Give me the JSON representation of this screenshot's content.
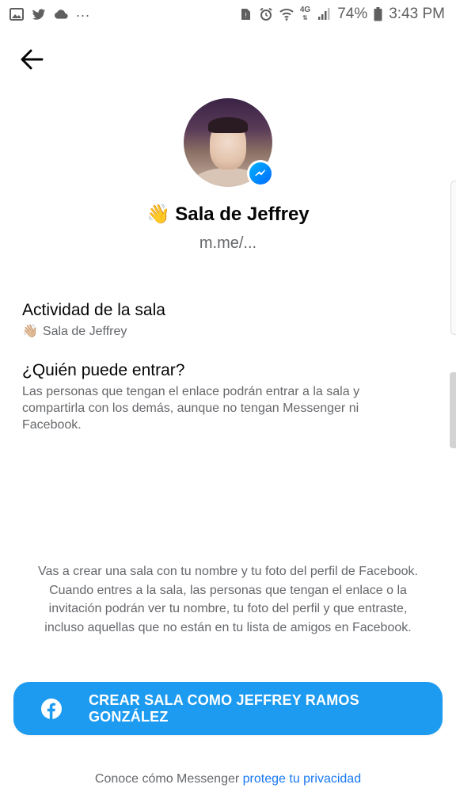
{
  "status_bar": {
    "left_icons": [
      "image-icon",
      "twitter-icon",
      "cloud-icon"
    ],
    "dots": "...",
    "right_icons": [
      "no-sim-icon",
      "alarm-icon",
      "wifi-icon",
      "network-4g-icon",
      "signal-icon",
      "battery-icon"
    ],
    "network_label": "4G",
    "battery": "74%",
    "time": "3:43 PM"
  },
  "header": {
    "back_icon": "arrow-left-icon"
  },
  "room": {
    "emoji": "👋",
    "name": "Sala de Jeffrey",
    "link": "m.me/..."
  },
  "activity": {
    "title": "Actividad de la sala",
    "emoji": "👋🏼",
    "value": "Sala de Jeffrey"
  },
  "who_can_join": {
    "title": "¿Quién puede entrar?",
    "description": "Las personas que tengan el enlace podrán entrar a la sala y compartirla con los demás, aunque no tengan Messenger ni Facebook."
  },
  "disclaimer": "Vas a crear una sala con tu nombre y tu foto del perfil de Facebook. Cuando entres a la sala, las personas que tengan el enlace o la invitación podrán ver tu nombre, tu foto del perfil y que entraste, incluso aquellas que no están en tu lista de amigos en Facebook.",
  "create_button": {
    "icon": "facebook-icon",
    "label": "CREAR SALA COMO JEFFREY RAMOS GONZÁLEZ"
  },
  "footer": {
    "prefix": "Conoce cómo Messenger ",
    "link": "protege tu privacidad"
  },
  "colors": {
    "primary_button": "#1d9bf0",
    "link": "#1877f2",
    "secondary_text": "#65676b",
    "messenger_badge": "#0a7cff"
  }
}
